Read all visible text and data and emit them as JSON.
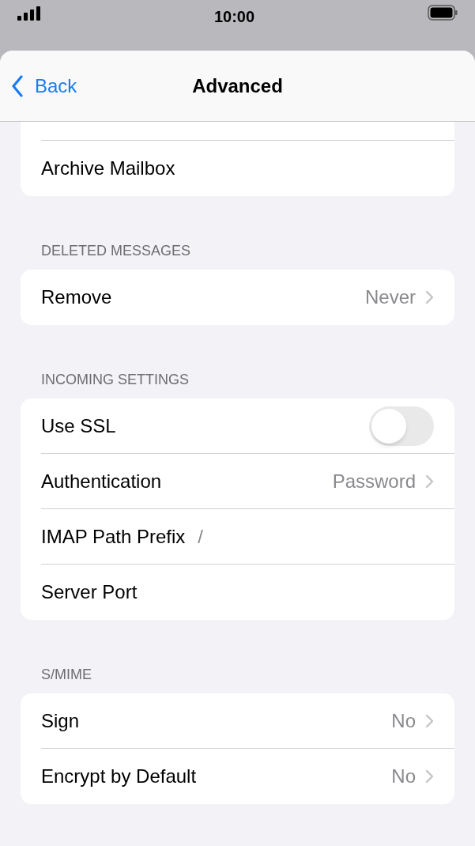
{
  "status_bar": {
    "time": "10:00"
  },
  "nav": {
    "back": "Back",
    "title": "Advanced"
  },
  "sections": [
    {
      "rows": [
        {
          "kind": "plain",
          "label": "Archive Mailbox"
        }
      ]
    },
    {
      "header": "DELETED MESSAGES",
      "rows": [
        {
          "kind": "value",
          "label": "Remove",
          "value": "Never"
        }
      ]
    },
    {
      "header": "INCOMING SETTINGS",
      "rows": [
        {
          "kind": "toggle",
          "label": "Use SSL",
          "on": false
        },
        {
          "kind": "value",
          "label": "Authentication",
          "value": "Password"
        },
        {
          "kind": "field",
          "label": "IMAP Path Prefix",
          "value": "/"
        },
        {
          "kind": "field",
          "label": "Server Port"
        }
      ]
    },
    {
      "header": "S/MIME",
      "rows": [
        {
          "kind": "value",
          "label": "Sign",
          "value": "No"
        },
        {
          "kind": "value",
          "label": "Encrypt by Default",
          "value": "No"
        }
      ]
    }
  ]
}
